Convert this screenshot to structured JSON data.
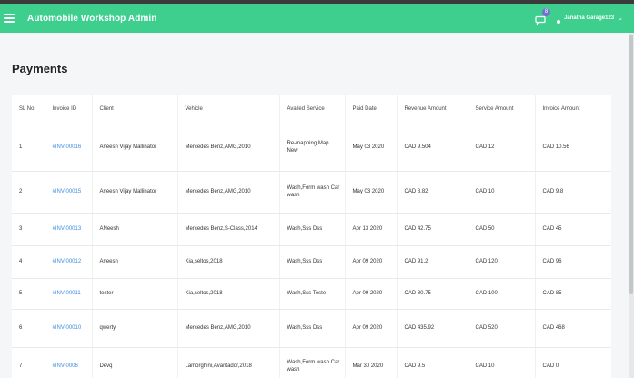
{
  "header": {
    "app_title": "Automobile Workshop Admin",
    "chat_badge_count": "8",
    "user_name": "Janatha Garage123",
    "caret": "⌄"
  },
  "page_title": "Payments",
  "table": {
    "columns": [
      "SL No.",
      "Invoice ID",
      "Client",
      "Vehicle",
      "Availed Service",
      "Paid Date",
      "Revenue Amount",
      "Service Amount",
      "Invoice Amount"
    ],
    "rows": [
      [
        "1",
        "#INV-00016",
        "Aneesh Vijay Mallinator",
        "Mercedes Benz,AMG,2010",
        "Re-mapping,Map New",
        "May 03 2020",
        "CAD 9.504",
        "CAD 12",
        "CAD 10.56"
      ],
      [
        "2",
        "#INV-00015",
        "Aneesh Vijay Mallinator",
        "Mercedes Benz,AMG,2010",
        "Wash,Form wash Car wash",
        "May 03 2020",
        "CAD 8.82",
        "CAD 10",
        "CAD 9.8"
      ],
      [
        "3",
        "#INV-00013",
        "ANeesh",
        "Mercedes Benz,S-Class,2014",
        "Wash,Sss Dss",
        "Apr 13 2020",
        "CAD 42.75",
        "CAD 50",
        "CAD 45"
      ],
      [
        "4",
        "#INV-00012",
        "Aneesh",
        "Kia,seltos,2018",
        "Wash,Sss Dss",
        "Apr 09 2020",
        "CAD 91.2",
        "CAD 120",
        "CAD 96"
      ],
      [
        "5",
        "#INV-00011",
        "tester",
        "Kia,seltos,2018",
        "Wash,Sss Teste",
        "Apr 09 2020",
        "CAD 80.75",
        "CAD 100",
        "CAD 85"
      ],
      [
        "6",
        "#INV-00010",
        "qwerty",
        "Mercedes Benz,AMG,2010",
        "Wash,Sss Dss",
        "Apr 09 2020",
        "CAD 435.92",
        "CAD 520",
        "CAD 468"
      ],
      [
        "7",
        "#INV-0006",
        "Devq",
        "Lamorghini,Avantador,2018",
        "Wash,Form wash Car wash",
        "Mar 30 2020",
        "CAD 9.5",
        "CAD 10",
        "CAD 0"
      ]
    ]
  },
  "colors": {
    "navbar": "#3ecf8e",
    "link": "#3d8de0",
    "badge": "#7b6bd6"
  }
}
